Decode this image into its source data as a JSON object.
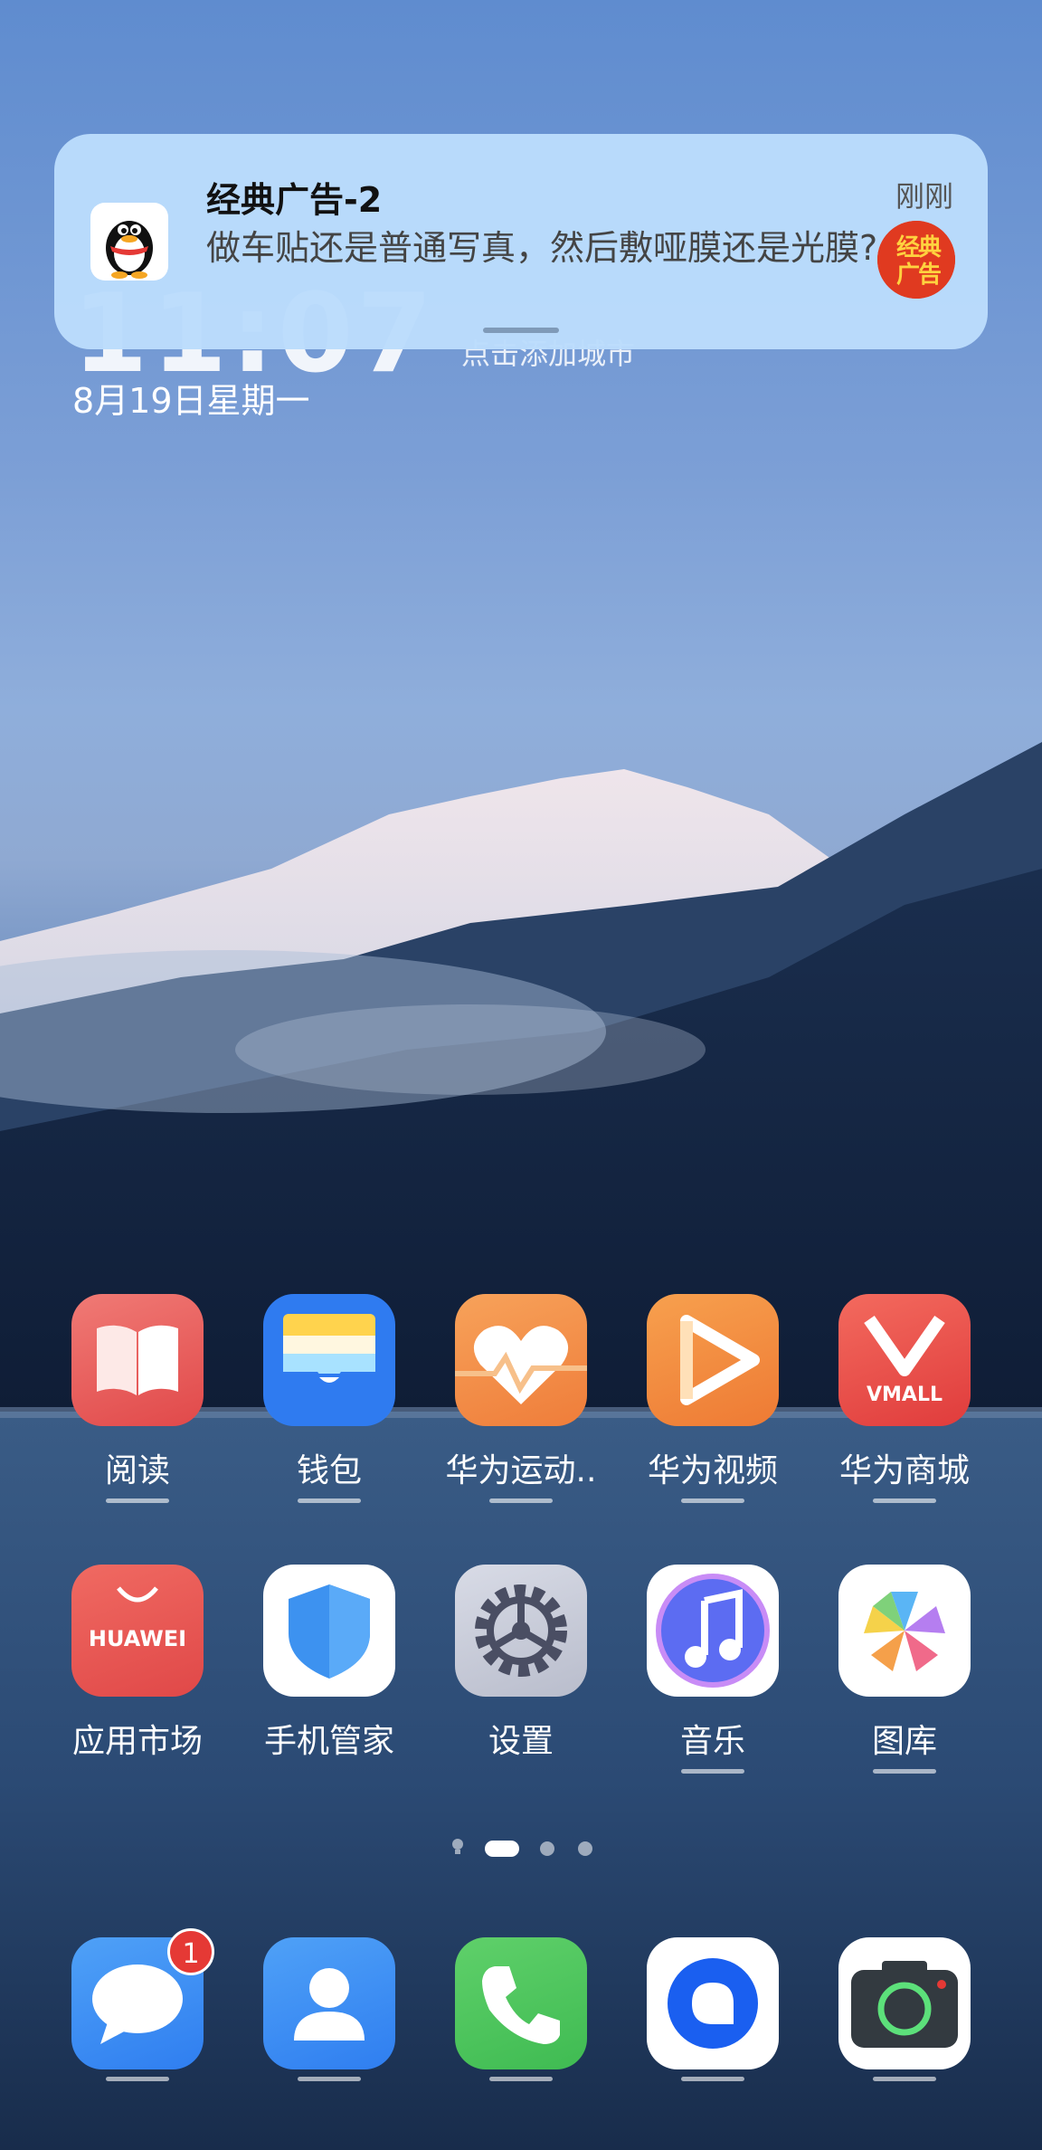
{
  "clock": {
    "time": "11:07",
    "date": "8月19日星期一",
    "weather": "点击添加城市"
  },
  "notification": {
    "app_icon": "qq-penguin-icon",
    "title": "经典广告-2",
    "body": "做车贴还是普通写真，然后敷哑膜还是光膜?",
    "time": "刚刚",
    "badge_icon": "classic-ad-logo-icon",
    "badge_text": "经典广告"
  },
  "apps_row1": [
    {
      "label": "阅读",
      "icon": "book-icon"
    },
    {
      "label": "钱包",
      "icon": "wallet-icon"
    },
    {
      "label": "华为运动..",
      "icon": "health-heart-icon"
    },
    {
      "label": "华为视频",
      "icon": "video-play-icon"
    },
    {
      "label": "华为商城",
      "icon": "vmall-icon",
      "icon_text": "VMALL"
    }
  ],
  "apps_row2": [
    {
      "label": "应用市场",
      "icon": "app-gallery-icon",
      "icon_text": "HUAWEI"
    },
    {
      "label": "手机管家",
      "icon": "shield-icon"
    },
    {
      "label": "设置",
      "icon": "gear-icon"
    },
    {
      "label": "音乐",
      "icon": "music-note-icon"
    },
    {
      "label": "图库",
      "icon": "gallery-pinwheel-icon"
    }
  ],
  "page_indicator": {
    "pages": 3,
    "active": 1
  },
  "dock": [
    {
      "name": "messages",
      "icon": "message-bubble-icon",
      "badge": "1"
    },
    {
      "name": "contacts",
      "icon": "contact-person-icon"
    },
    {
      "name": "phone",
      "icon": "phone-handset-icon"
    },
    {
      "name": "browser",
      "icon": "browser-icon"
    },
    {
      "name": "camera",
      "icon": "camera-icon"
    }
  ],
  "colors": {
    "notification_bg": "#bbdcfc",
    "badge_red": "#e53935"
  }
}
